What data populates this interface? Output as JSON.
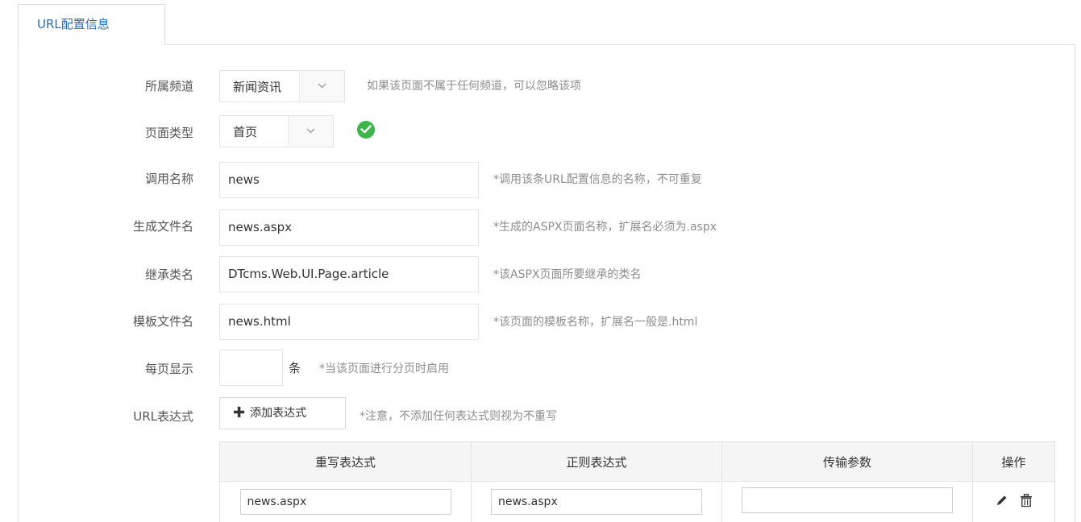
{
  "tab": {
    "label": "URL配置信息"
  },
  "form": {
    "channel": {
      "label": "所属频道",
      "value": "新闻资讯",
      "hint": "如果该页面不属于任何频道，可以忽略该项"
    },
    "page_type": {
      "label": "页面类型",
      "value": "首页"
    },
    "call_name": {
      "label": "调用名称",
      "value": "news",
      "hint": "*调用该条URL配置信息的名称，不可重复"
    },
    "file_name": {
      "label": "生成文件名",
      "value": "news.aspx",
      "hint": "*生成的ASPX页面名称，扩展名必须为.aspx"
    },
    "inherit_class": {
      "label": "继承类名",
      "value": "DTcms.Web.UI.Page.article",
      "hint": "*该ASPX页面所要继承的类名"
    },
    "template_file": {
      "label": "模板文件名",
      "value": "news.html",
      "hint": "*该页面的模板名称，扩展名一般是.html"
    },
    "page_size": {
      "label": "每页显示",
      "value": "",
      "unit": "条",
      "hint": "*当该页面进行分页时启用"
    },
    "url_expr": {
      "label": "URL表达式",
      "button": "添加表达式",
      "hint": "*注意，不添加任何表达式则视为不重写"
    }
  },
  "table": {
    "headers": [
      "重写表达式",
      "正则表达式",
      "传输参数",
      "操作"
    ],
    "rows": [
      {
        "rewrite": "news.aspx",
        "regex": "news.aspx",
        "params": ""
      }
    ]
  },
  "colors": {
    "accent": "#2b6cb5",
    "success": "#3cb54a"
  },
  "icons": {
    "dropdown": "chevron-down-icon",
    "valid": "check-circle-icon",
    "add": "plus-icon",
    "edit": "pencil-icon",
    "delete": "trash-icon"
  }
}
